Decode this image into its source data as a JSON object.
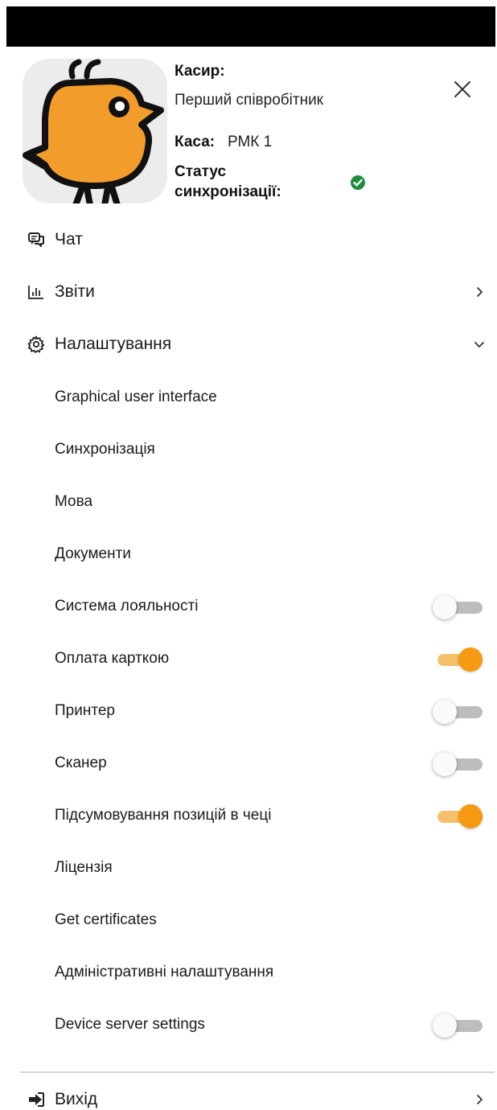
{
  "header": {
    "cashier_label": "Касир:",
    "cashier_name": "Перший співробітник",
    "register_label": "Каса:",
    "register_value": "РМК 1",
    "sync_status_label_line1": "Статус",
    "sync_status_label_line2": "синхронізації:",
    "sync_status_icon": "check-circle-icon",
    "sync_status_color": "#1e8e3e"
  },
  "menu": {
    "chat": {
      "label": "Чат",
      "icon": "chat-icon"
    },
    "reports": {
      "label": "Звіти",
      "icon": "bar-chart-icon"
    },
    "settings": {
      "label": "Налаштування",
      "icon": "gear-icon",
      "expanded": true,
      "items": [
        {
          "label": "Graphical user interface"
        },
        {
          "label": "Синхронізація"
        },
        {
          "label": "Мова"
        },
        {
          "label": "Документи"
        },
        {
          "label": "Система лояльності",
          "toggle": false
        },
        {
          "label": "Оплата карткою",
          "toggle": true
        },
        {
          "label": "Принтер",
          "toggle": false
        },
        {
          "label": "Сканер",
          "toggle": false
        },
        {
          "label": "Підсумовування позицій в чеці",
          "toggle": true
        },
        {
          "label": "Ліцензія"
        },
        {
          "label": "Get certificates"
        },
        {
          "label": "Адміністративні налаштування"
        },
        {
          "label": "Device server settings",
          "toggle": false
        }
      ]
    },
    "logout": {
      "label": "Вихід",
      "icon": "logout-icon"
    }
  },
  "colors": {
    "accent": "#f59a12",
    "accent_track": "#f5c06a",
    "toggle_off_track": "#bdbdbd",
    "mascot": "#f29d2b",
    "top_bar": "#000000"
  }
}
